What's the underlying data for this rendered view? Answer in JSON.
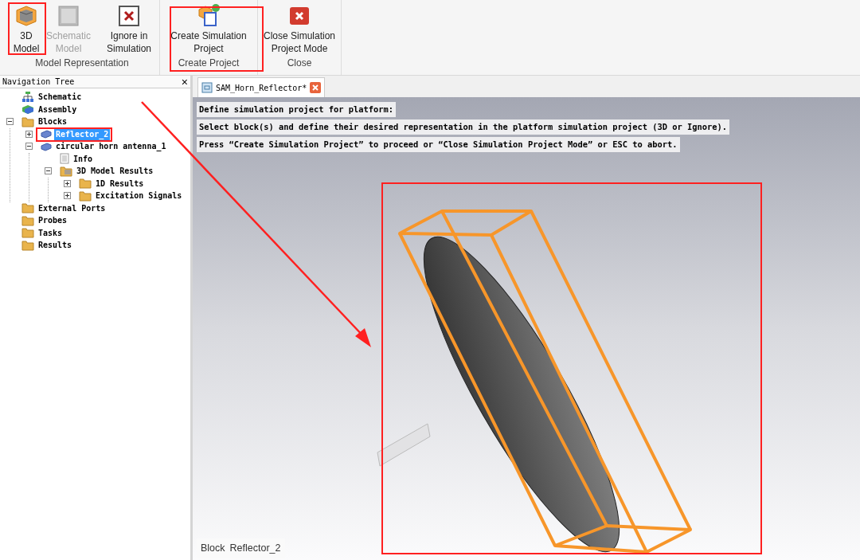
{
  "ribbon": {
    "groups": [
      {
        "label": "Model Representation",
        "buttons": [
          {
            "lines": [
              "3D",
              "Model"
            ],
            "kind": "cube",
            "disabled": false
          },
          {
            "lines": [
              "Schematic",
              "Model"
            ],
            "kind": "schematic",
            "disabled": true
          },
          {
            "lines": [
              "Ignore in",
              "Simulation"
            ],
            "kind": "ignore",
            "disabled": false
          }
        ]
      },
      {
        "label": "Create Project",
        "buttons": [
          {
            "lines": [
              "Create Simulation",
              "Project"
            ],
            "kind": "create",
            "disabled": false
          }
        ]
      },
      {
        "label": "Close",
        "buttons": [
          {
            "lines": [
              "Close Simulation",
              "Project Mode"
            ],
            "kind": "close",
            "disabled": false
          }
        ]
      }
    ]
  },
  "navigation_tree": {
    "title": "Navigation Tree",
    "close": "×",
    "items": [
      {
        "label": "Schematic",
        "kind": "schematic",
        "selected": false
      },
      {
        "label": "Assembly",
        "kind": "assembly",
        "selected": false
      },
      {
        "label": "Blocks",
        "kind": "folder",
        "selected": false,
        "expanded": true,
        "children": [
          {
            "label": "Reflector_2",
            "kind": "block",
            "selected": true,
            "expanded": false
          },
          {
            "label": "circular horn antenna_1",
            "kind": "block",
            "selected": false,
            "expanded": true,
            "children": [
              {
                "label": "Info",
                "kind": "doc",
                "selected": false
              },
              {
                "label": "3D Model Results",
                "kind": "results",
                "selected": false,
                "expanded": true,
                "children": [
                  {
                    "label": "1D Results",
                    "kind": "folder",
                    "selected": false,
                    "expanded": false
                  },
                  {
                    "label": "Excitation Signals",
                    "kind": "folder",
                    "selected": false,
                    "expanded": false
                  }
                ]
              }
            ]
          }
        ]
      },
      {
        "label": "External Ports",
        "kind": "folder",
        "selected": false
      },
      {
        "label": "Probes",
        "kind": "folder",
        "selected": false
      },
      {
        "label": "Tasks",
        "kind": "folder",
        "selected": false
      },
      {
        "label": "Results",
        "kind": "folder",
        "selected": false
      }
    ]
  },
  "document_tab": {
    "title": "SAM_Horn_Reflector*",
    "selected": true
  },
  "viewport": {
    "messages": [
      "Define simulation project for platform:",
      "Select block(s) and define their desired representation in the platform simulation project (3D or Ignore).",
      "Press “Create Simulation Project” to proceed or “Close Simulation Project Mode” or ESC to abort."
    ],
    "status_label": "Block",
    "status_value": "Reflector_2"
  }
}
